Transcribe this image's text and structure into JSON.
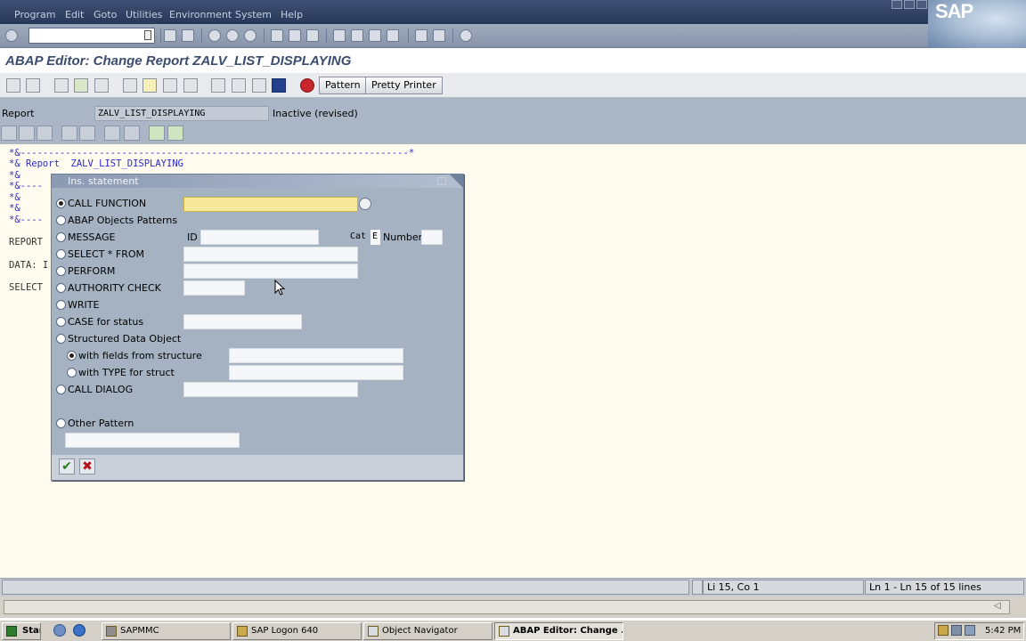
{
  "menu": {
    "items": [
      {
        "label": "Program"
      },
      {
        "label": "Edit"
      },
      {
        "label": "Goto"
      },
      {
        "label": "Utilities"
      },
      {
        "label": "Environment"
      },
      {
        "label": "System"
      },
      {
        "label": "Help"
      }
    ],
    "logo": "SAP"
  },
  "title": "ABAP Editor: Change Report ZALV_LIST_DISPLAYING",
  "app_toolbar": {
    "pattern_label": "Pattern",
    "pretty_printer_label": "Pretty Printer"
  },
  "report_bar": {
    "label": "Report",
    "value": "ZALV_LIST_DISPLAYING",
    "status": "Inactive (revised)"
  },
  "code_lines": [
    "*&---------------------------------------------------------------------*",
    "*& Report  ZALV_LIST_DISPLAYING",
    "*&",
    "*&----",
    "*&",
    "*&",
    "*&",
    "*&----",
    "REPORT",
    "DATA: I",
    "SELECT"
  ],
  "dialog": {
    "title": "Ins. statement",
    "options": [
      {
        "label": "CALL FUNCTION",
        "selected": true
      },
      {
        "label": "ABAP Objects Patterns",
        "selected": false
      },
      {
        "label": "MESSAGE",
        "selected": false
      },
      {
        "label": "SELECT * FROM",
        "selected": false
      },
      {
        "label": "PERFORM",
        "selected": false
      },
      {
        "label": "AUTHORITY CHECK",
        "selected": false
      },
      {
        "label": "WRITE",
        "selected": false
      },
      {
        "label": "CASE for status",
        "selected": false
      },
      {
        "label": "Structured Data Object",
        "selected": false
      },
      {
        "label": "with fields from structure",
        "selected": true
      },
      {
        "label": "with TYPE for struct",
        "selected": false
      },
      {
        "label": "CALL DIALOG",
        "selected": false
      },
      {
        "label": "Other Pattern",
        "selected": false
      }
    ],
    "message_id_label": "ID",
    "message_cat_label": "Cat",
    "message_cat_value": "E",
    "message_number_label": "Number"
  },
  "status_bar": {
    "position": "Li 15, Co 1",
    "lines": "Ln 1 - Ln 15 of 15 lines"
  },
  "taskbar": {
    "start_label": "Start",
    "tasks": [
      {
        "label": "SAPMMC",
        "active": false
      },
      {
        "label": "SAP Logon 640",
        "active": false
      },
      {
        "label": "Object Navigator",
        "active": false
      },
      {
        "label": "ABAP Editor: Change ...",
        "active": true
      }
    ],
    "clock": "5:42 PM"
  }
}
